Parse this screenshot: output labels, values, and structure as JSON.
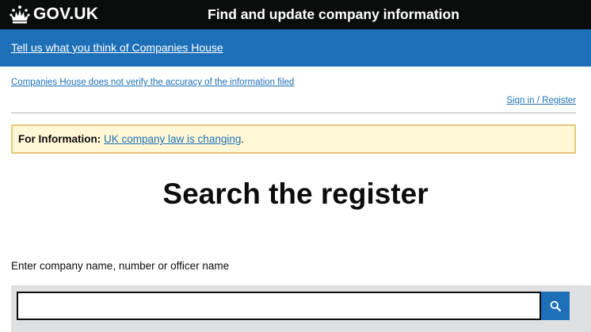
{
  "header": {
    "logo_text": "GOV.UK",
    "service_name": "Find and update company information"
  },
  "feedback": {
    "link_text": "Tell us what you think of Companies House"
  },
  "disclaimer": {
    "text": "Companies House does not verify the accuracy of the information filed"
  },
  "account": {
    "signin_text": "Sign in / Register"
  },
  "banner": {
    "label": "For Information:",
    "link_text": "UK company law is changing",
    "suffix": "."
  },
  "main": {
    "title": "Search the register"
  },
  "search": {
    "label": "Enter company name, number or officer name",
    "value": "",
    "button_icon": "search-icon"
  },
  "colors": {
    "header_bg": "#0b0c0c",
    "brand_blue": "#1d70b8",
    "banner_bg": "#fff7d6",
    "banner_border": "#e4c97e",
    "search_panel_bg": "#dee0e2"
  }
}
